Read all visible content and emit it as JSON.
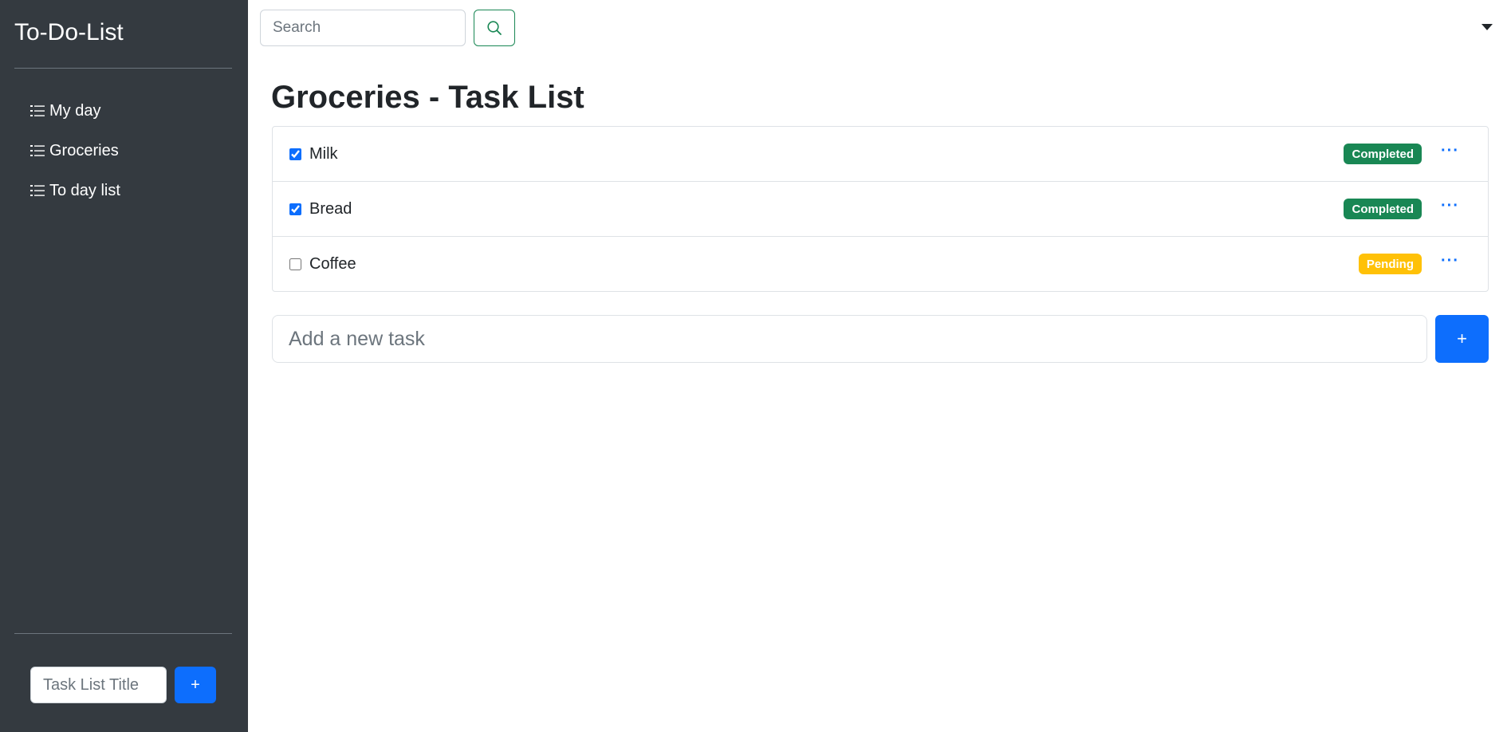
{
  "sidebar": {
    "brand": "To-Do-List",
    "items": [
      {
        "label": "My day",
        "icon": "list-task-icon"
      },
      {
        "label": "Groceries",
        "icon": "list-task-icon"
      },
      {
        "label": "To day list",
        "icon": "list-task-icon"
      }
    ],
    "new_list": {
      "placeholder": "Task List Title",
      "button_label": "+"
    }
  },
  "topbar": {
    "search_placeholder": "Search",
    "search_icon": "search-icon",
    "dropdown_icon": "caret-down-icon"
  },
  "main": {
    "title": "Groceries - Task List",
    "tasks": [
      {
        "name": "Milk",
        "checked": true,
        "status": "Completed"
      },
      {
        "name": "Bread",
        "checked": true,
        "status": "Completed"
      },
      {
        "name": "Coffee",
        "checked": false,
        "status": "Pending"
      }
    ],
    "more_label": "···",
    "add_task": {
      "placeholder": "Add a new task",
      "button_label": "+"
    }
  },
  "colors": {
    "sidebar_bg": "#343a40",
    "primary": "#0d6efd",
    "success": "#198754",
    "warning": "#ffc107"
  }
}
